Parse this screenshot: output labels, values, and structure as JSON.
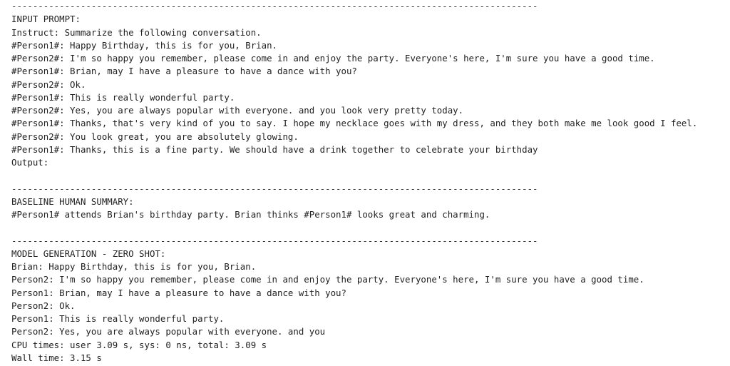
{
  "cell_output": {
    "lines": [
      "---------------------------------------------------------------------------------------------------",
      "INPUT PROMPT:",
      "Instruct: Summarize the following conversation.",
      "#Person1#: Happy Birthday, this is for you, Brian.",
      "#Person2#: I'm so happy you remember, please come in and enjoy the party. Everyone's here, I'm sure you have a good time.",
      "#Person1#: Brian, may I have a pleasure to have a dance with you?",
      "#Person2#: Ok.",
      "#Person1#: This is really wonderful party.",
      "#Person2#: Yes, you are always popular with everyone. and you look very pretty today.",
      "#Person1#: Thanks, that's very kind of you to say. I hope my necklace goes with my dress, and they both make me look good I feel.",
      "#Person2#: You look great, you are absolutely glowing.",
      "#Person1#: Thanks, this is a fine party. We should have a drink together to celebrate your birthday",
      "Output:",
      "",
      "---------------------------------------------------------------------------------------------------",
      "BASELINE HUMAN SUMMARY:",
      "#Person1# attends Brian's birthday party. Brian thinks #Person1# looks great and charming.",
      "",
      "---------------------------------------------------------------------------------------------------",
      "MODEL GENERATION - ZERO SHOT:",
      "Brian: Happy Birthday, this is for you, Brian.",
      "Person2: I'm so happy you remember, please come in and enjoy the party. Everyone's here, I'm sure you have a good time.",
      "Person1: Brian, may I have a pleasure to have a dance with you?",
      "Person2: Ok.",
      "Person1: This is really wonderful party.",
      "Person2: Yes, you are always popular with everyone. and you",
      "CPU times: user 3.09 s, sys: 0 ns, total: 3.09 s",
      "Wall time: 3.15 s"
    ]
  }
}
